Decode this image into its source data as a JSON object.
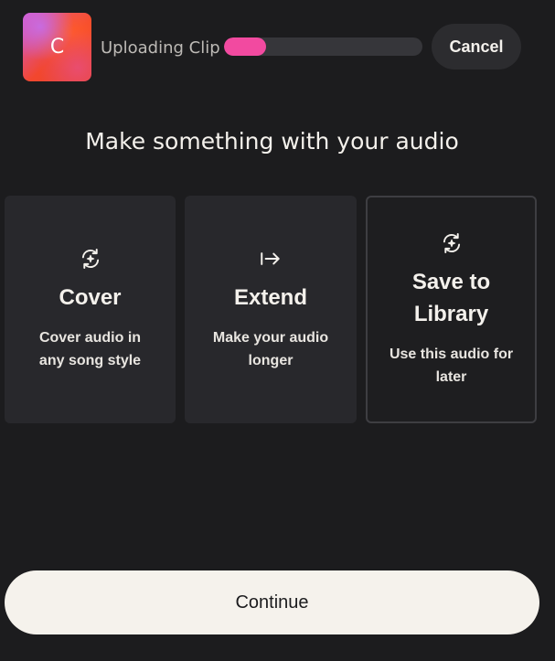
{
  "upload": {
    "thumbnail_letter": "C",
    "label": "Uploading Clip",
    "progress": 0.21,
    "progress_color": "#f24aa0",
    "cancel_label": "Cancel"
  },
  "heading": "Make something with your audio",
  "options": [
    {
      "icon": "cover-icon",
      "title": "Cover",
      "description": "Cover audio in any song style",
      "selected": false
    },
    {
      "icon": "extend-icon",
      "title": "Extend",
      "description": "Make your audio longer",
      "selected": false
    },
    {
      "icon": "save-to-library-icon",
      "title": "Save to Library",
      "description": "Use this audio for later",
      "selected": true
    }
  ],
  "continue_label": "Continue",
  "colors": {
    "background": "#1c1c1e",
    "card": "#28282c",
    "continue_bg": "#f5f2ec"
  }
}
